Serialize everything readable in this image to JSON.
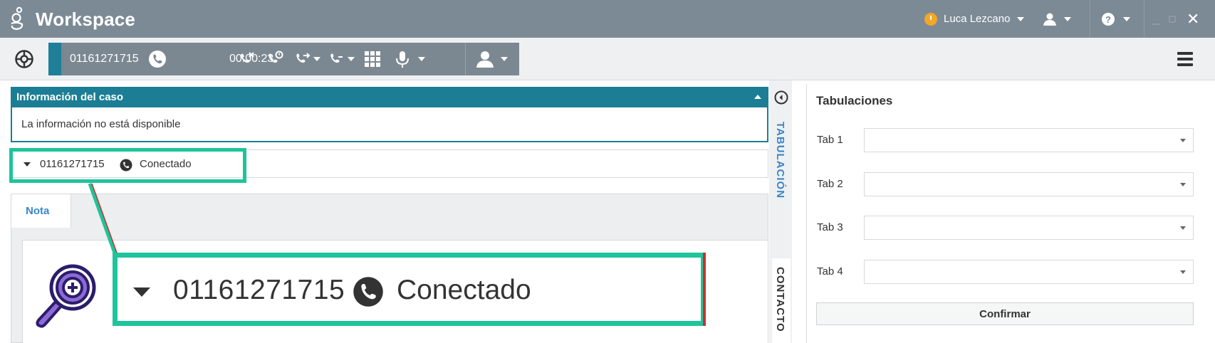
{
  "titlebar": {
    "app_title": "Workspace",
    "user_name": "Luca Lezcano",
    "status_color": "#f5a623",
    "close_symbol": "✕"
  },
  "toolbar": {
    "call_number": "01161271715",
    "call_timer": "00:00:23"
  },
  "case_info": {
    "header": "Información del caso",
    "body": "La información no está disponible"
  },
  "interaction": {
    "number": "01161271715",
    "status": "Conectado"
  },
  "note": {
    "tab_label": "Nota"
  },
  "zoom_callout": {
    "number": "01161271715",
    "status": "Conectado",
    "highlight_color": "#1ec49b"
  },
  "side_tabs": {
    "tab1": "TABULACIÓN",
    "tab2": "CONTACTO"
  },
  "tabulaciones": {
    "title": "Tabulaciones",
    "rows": [
      {
        "label": "Tab 1",
        "value": ""
      },
      {
        "label": "Tab 2",
        "value": ""
      },
      {
        "label": "Tab 3",
        "value": ""
      },
      {
        "label": "Tab 4",
        "value": ""
      }
    ],
    "confirm_label": "Confirmar"
  },
  "colors": {
    "titlebar_bg": "#7c8a96",
    "accent_teal": "#1b7e95",
    "link_blue": "#3a86c8"
  }
}
